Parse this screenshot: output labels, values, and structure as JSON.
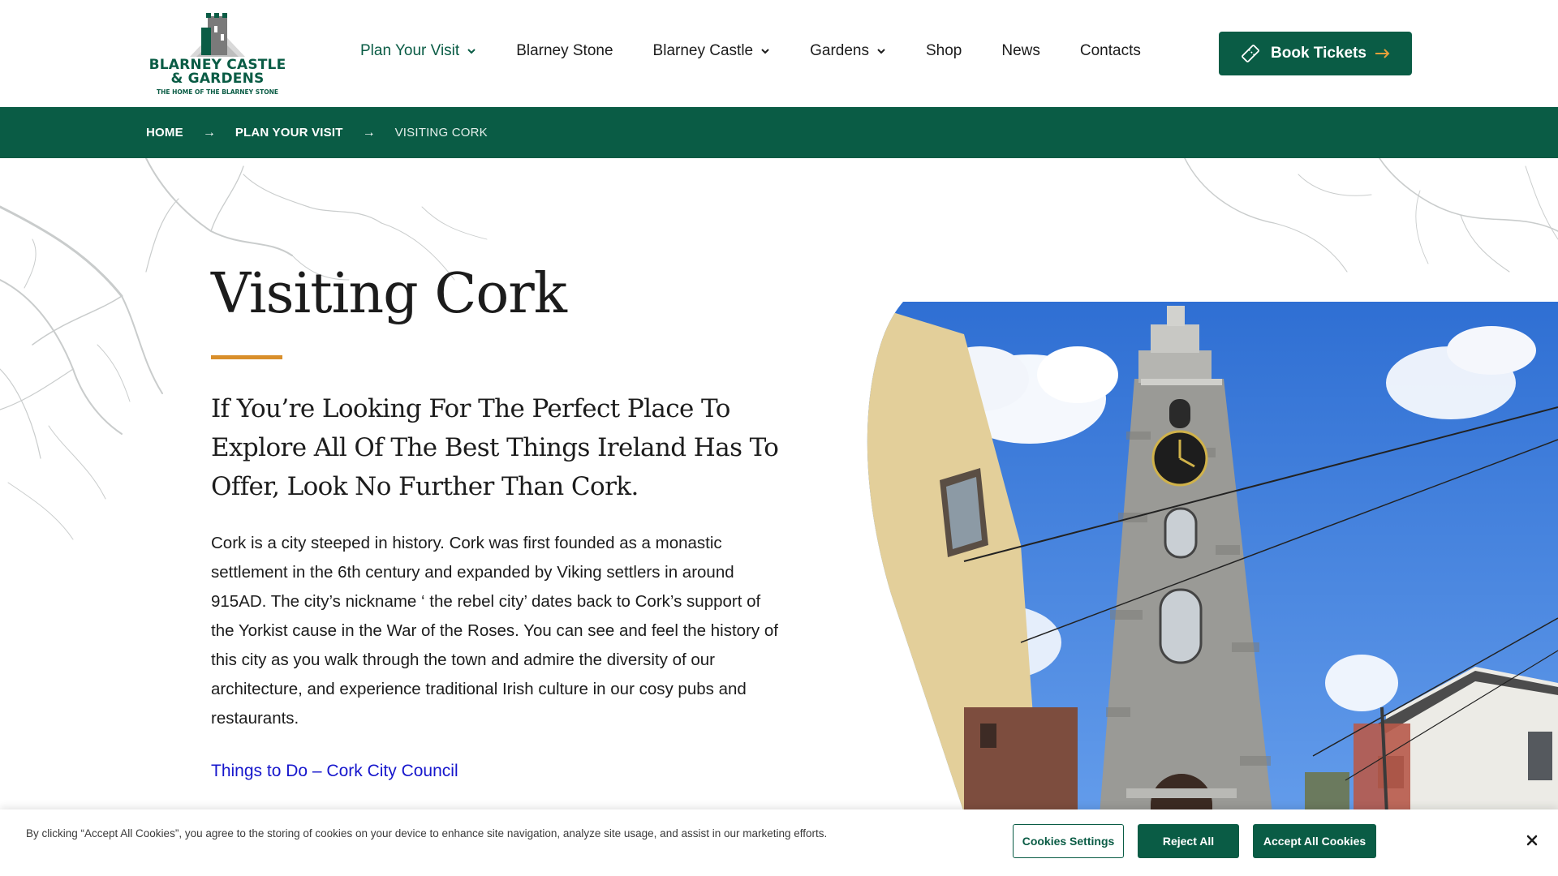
{
  "logo": {
    "line1": "BLARNEY CASTLE",
    "line2": "& GARDENS",
    "tagline": "THE HOME OF THE BLARNEY STONE",
    "color": "#0a5c45"
  },
  "nav": {
    "items": [
      {
        "label": "Plan Your Visit",
        "dropdown": true,
        "active": true
      },
      {
        "label": "Blarney Stone",
        "dropdown": false
      },
      {
        "label": "Blarney Castle",
        "dropdown": true
      },
      {
        "label": "Gardens",
        "dropdown": true
      },
      {
        "label": "Shop",
        "dropdown": false
      },
      {
        "label": "News",
        "dropdown": false
      },
      {
        "label": "Contacts",
        "dropdown": false
      }
    ],
    "cta": {
      "label": "Book Tickets",
      "icon": "ticket-icon",
      "arrow_icon": "arrow-right-icon"
    }
  },
  "breadcrumb": {
    "items": [
      "HOME",
      "PLAN YOUR VISIT",
      "VISITING CORK"
    ],
    "separator": "→"
  },
  "main": {
    "title": "Visiting Cork",
    "lead": "If You’re Looking For The Perfect Place To Explore All Of The Best Things Ireland Has To Offer, Look No Further Than Cork.",
    "body": "Cork is a city steeped in history. Cork was first founded as a monastic settlement in the 6th century and expanded by Viking settlers in around 915AD. The city’s nickname ‘ the rebel city’ dates back to Cork’s support of the Yorkist cause in the War of the Roses. You can see and feel the history of this city as you walk through the town and admire the diversity of our architecture, and experience traditional Irish culture in our cosy pubs and restaurants.",
    "link": "Things to Do – Cork City Council",
    "image": "shandon-bell-tower-photo"
  },
  "cookie": {
    "text": "By clicking “Accept All Cookies”, you agree to the storing of cookies on your device to enhance site navigation, analyze site usage, and assist in our marketing efforts.",
    "settings": "Cookies Settings",
    "reject": "Reject All",
    "accept": "Accept All Cookies"
  },
  "colors": {
    "brand_green": "#0a5c45",
    "accent_orange": "#d98f2b",
    "link_blue": "#1616cc"
  }
}
